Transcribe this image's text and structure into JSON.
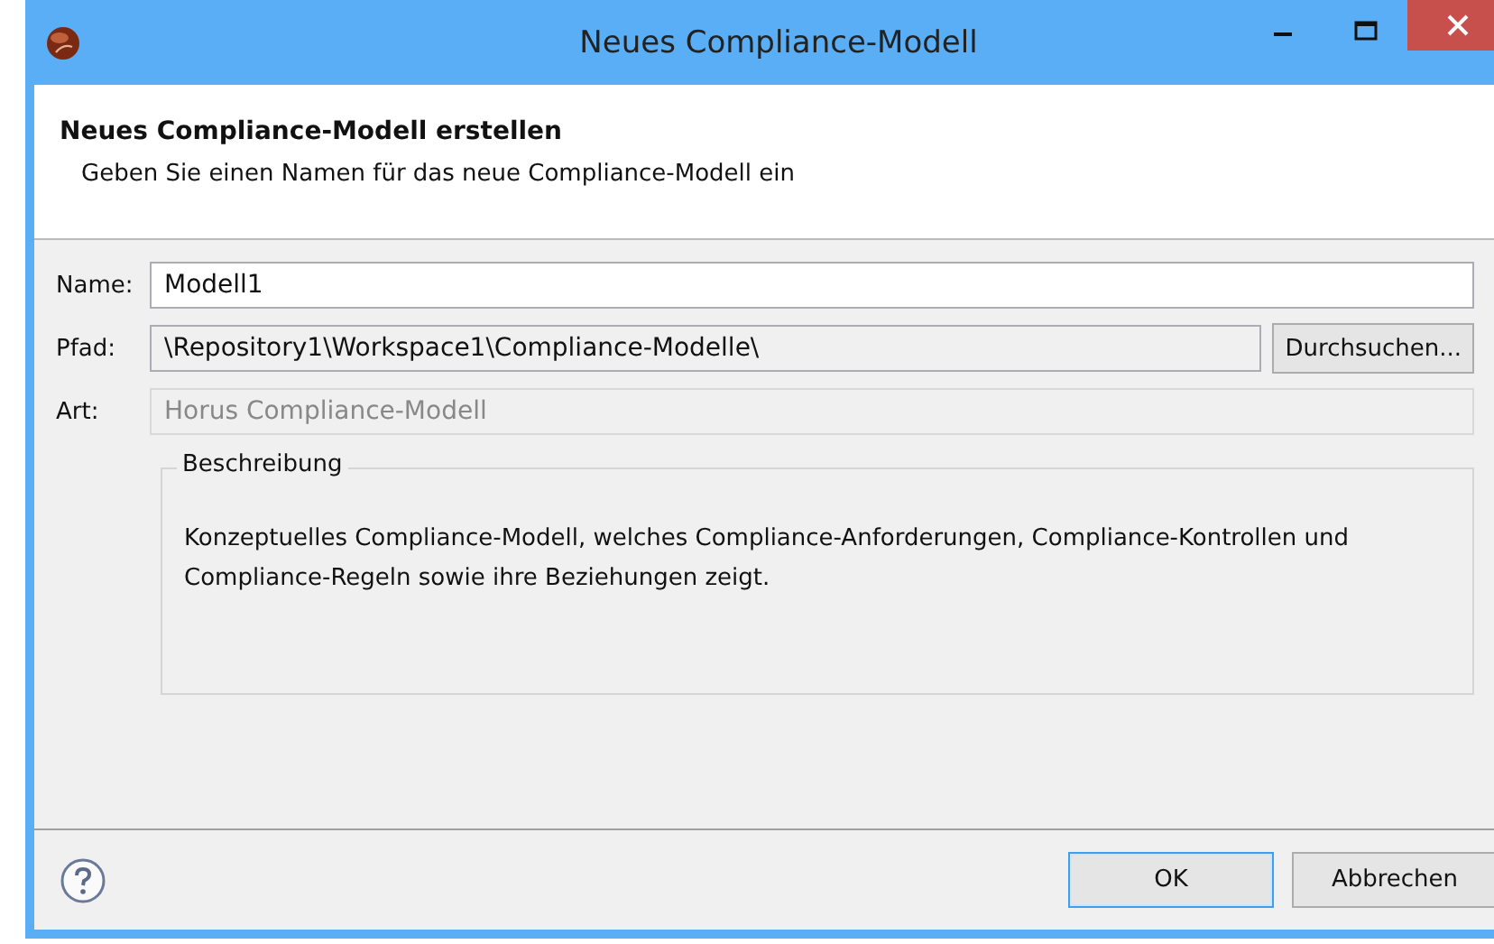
{
  "window": {
    "title": "Neues Compliance-Modell"
  },
  "header": {
    "title": "Neues Compliance-Modell erstellen",
    "message": "Geben Sie einen Namen für das neue Compliance-Modell ein"
  },
  "fields": [
    {
      "label": "Name:",
      "value": "Modell1",
      "disabled": false,
      "editable": true
    },
    {
      "label": "Pfad:",
      "value": "\\Repository1\\Workspace1\\Compliance-Modelle\\",
      "disabled": false,
      "editable": false,
      "button": "Durchsuchen..."
    },
    {
      "label": "Art:",
      "value": "Horus Compliance-Modell",
      "disabled": true,
      "editable": false
    }
  ],
  "description": {
    "title": "Beschreibung",
    "text": "Konzeptuelles Compliance-Modell, welches Compliance-Anforderungen, Compliance-Kontrollen und Compliance-Regeln sowie ihre Beziehungen zeigt."
  },
  "buttons": [
    {
      "label": "OK",
      "default": true
    },
    {
      "label": "Abbrechen",
      "default": false
    }
  ]
}
